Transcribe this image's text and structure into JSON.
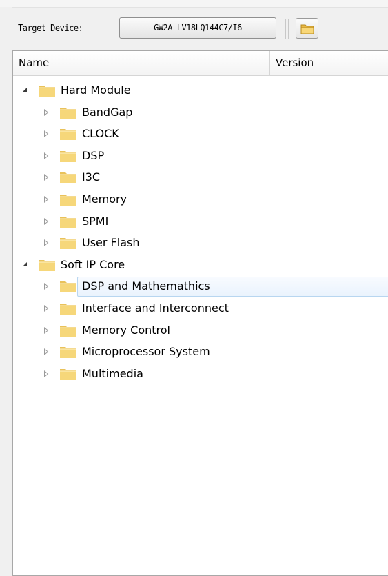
{
  "toolbar": {
    "target_label": "Target Device:",
    "device_value": "GW2A-LV18LQ144C7/I6",
    "open_icon": "folder-icon"
  },
  "tree": {
    "columns": {
      "name": "Name",
      "version": "Version"
    },
    "nodes": [
      {
        "label": "Hard Module",
        "level": 0,
        "expanded": true
      },
      {
        "label": "BandGap",
        "level": 1,
        "expanded": false
      },
      {
        "label": "CLOCK",
        "level": 1,
        "expanded": false
      },
      {
        "label": "DSP",
        "level": 1,
        "expanded": false
      },
      {
        "label": "I3C",
        "level": 1,
        "expanded": false
      },
      {
        "label": "Memory",
        "level": 1,
        "expanded": false
      },
      {
        "label": "SPMI",
        "level": 1,
        "expanded": false
      },
      {
        "label": "User Flash",
        "level": 1,
        "expanded": false
      },
      {
        "label": "Soft IP Core",
        "level": 0,
        "expanded": true
      },
      {
        "label": "DSP and Mathemathics",
        "level": 1,
        "expanded": false,
        "selected": true
      },
      {
        "label": "Interface and Interconnect",
        "level": 1,
        "expanded": false
      },
      {
        "label": "Memory Control",
        "level": 1,
        "expanded": false
      },
      {
        "label": "Microprocessor System",
        "level": 1,
        "expanded": false
      },
      {
        "label": "Multimedia",
        "level": 1,
        "expanded": false
      }
    ]
  },
  "colors": {
    "folder_fill": "#f6d77a",
    "folder_tab": "#e9c25a",
    "selection_border": "#b8d6f0"
  }
}
